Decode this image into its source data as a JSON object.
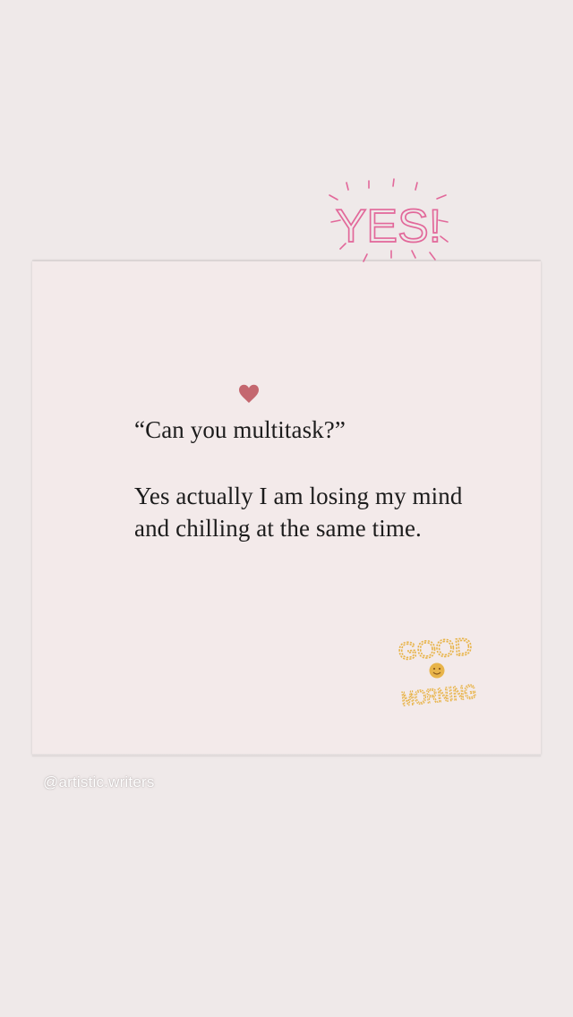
{
  "post": {
    "quote": "“Can you multitask?”",
    "answer": "Yes actually I am losing my mind and chilling at the same time."
  },
  "stickers": {
    "yes_text": "YES!",
    "good_text": "GOOD",
    "morning_text": "MORNING",
    "yes_color": "#e2689a",
    "morning_color": "#e8b44a"
  },
  "icons": {
    "heart": "heart-icon",
    "smiley": "smiley-icon"
  },
  "colors": {
    "background": "#efe9e9",
    "card": "#f3eaea",
    "heart": "#c4676f",
    "text": "#1c1c1c"
  },
  "footer": {
    "handle": "@artistic.writers"
  }
}
